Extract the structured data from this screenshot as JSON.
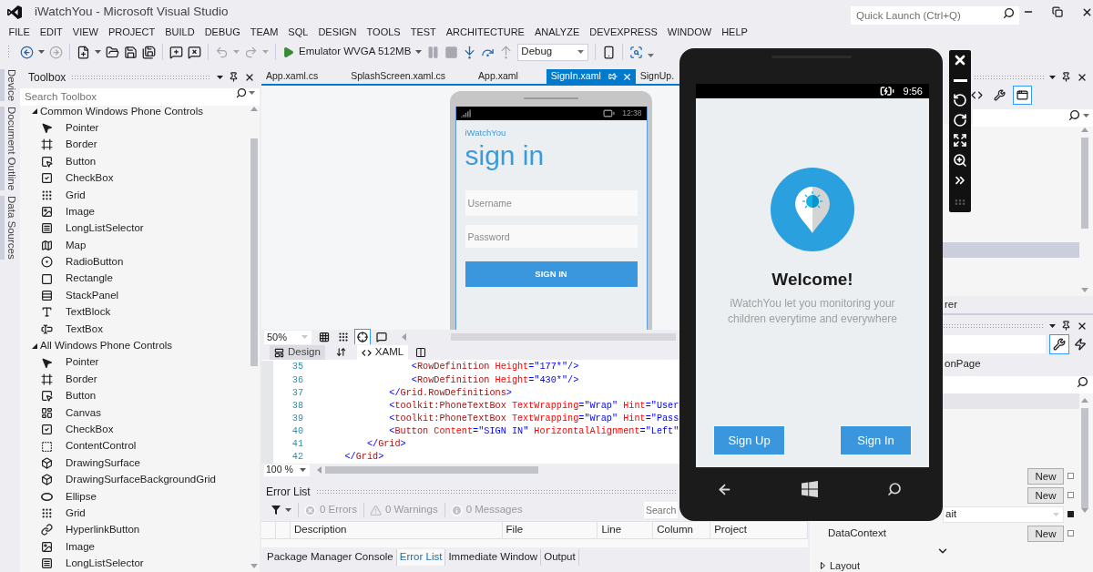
{
  "window": {
    "title": "iWatchYou - Microsoft Visual Studio",
    "quick_launch": {
      "placeholder": "Quick Launch (Ctrl+Q)"
    }
  },
  "menu": [
    "FILE",
    "EDIT",
    "VIEW",
    "PROJECT",
    "BUILD",
    "DEBUG",
    "TEAM",
    "SQL",
    "DESIGN",
    "TOOLS",
    "TEST",
    "ARCHITECTURE",
    "ANALYZE",
    "DEVEXPRESS",
    "WINDOW",
    "HELP"
  ],
  "toolbar": {
    "buttons": [
      {
        "kind": "back",
        "disabled": false
      },
      {
        "kind": "forward",
        "disabled": true
      },
      {
        "kind": "new",
        "disabled": false
      },
      {
        "kind": "open",
        "disabled": false
      },
      {
        "kind": "save",
        "disabled": false
      },
      {
        "kind": "saveall",
        "disabled": false
      },
      {
        "kind": "commentadd",
        "disabled": false
      },
      {
        "kind": "commentremove",
        "disabled": false
      },
      {
        "kind": "undo",
        "disabled": true
      },
      {
        "kind": "redo",
        "disabled": true
      }
    ],
    "target": "Emulator WVGA 512MB",
    "debug_buttons": [
      {
        "kind": "pause",
        "disabled": true
      },
      {
        "kind": "stop",
        "disabled": true
      },
      {
        "kind": "stepinto",
        "disabled": false
      },
      {
        "kind": "stepover",
        "disabled": false
      },
      {
        "kind": "stepout",
        "disabled": true
      }
    ],
    "configuration": "Debug"
  },
  "side_tabs": [
    "Device",
    "Document Outline",
    "Data Sources"
  ],
  "toolbox": {
    "title": "Toolbox",
    "search": {
      "placeholder": "Search Toolbox"
    },
    "groups": [
      {
        "name": "Common Windows Phone Controls",
        "expanded": true,
        "items": [
          {
            "label": "Pointer",
            "kind": "pointer"
          },
          {
            "label": "Border",
            "kind": "border"
          },
          {
            "label": "Button",
            "kind": "button"
          },
          {
            "label": "CheckBox",
            "kind": "checkbox"
          },
          {
            "label": "Grid",
            "kind": "grid"
          },
          {
            "label": "Image",
            "kind": "image"
          },
          {
            "label": "LongListSelector",
            "kind": "list"
          },
          {
            "label": "Map",
            "kind": "map"
          },
          {
            "label": "RadioButton",
            "kind": "radio"
          },
          {
            "label": "Rectangle",
            "kind": "rectangle"
          },
          {
            "label": "StackPanel",
            "kind": "stack"
          },
          {
            "label": "TextBlock",
            "kind": "text"
          },
          {
            "label": "TextBox",
            "kind": "textbox"
          }
        ]
      },
      {
        "name": "All Windows Phone Controls",
        "expanded": true,
        "items": [
          {
            "label": "Pointer",
            "kind": "pointer"
          },
          {
            "label": "Border",
            "kind": "border"
          },
          {
            "label": "Button",
            "kind": "button"
          },
          {
            "label": "Canvas",
            "kind": "canvas"
          },
          {
            "label": "CheckBox",
            "kind": "checkbox"
          },
          {
            "label": "ContentControl",
            "kind": "content"
          },
          {
            "label": "DrawingSurface",
            "kind": "surface"
          },
          {
            "label": "DrawingSurfaceBackgroundGrid",
            "kind": "surface"
          },
          {
            "label": "Ellipse",
            "kind": "ellipse"
          },
          {
            "label": "Grid",
            "kind": "grid"
          },
          {
            "label": "HyperlinkButton",
            "kind": "hyperlink"
          },
          {
            "label": "Image",
            "kind": "image"
          },
          {
            "label": "LongListSelector",
            "kind": "list"
          }
        ]
      }
    ]
  },
  "document_tabs": [
    {
      "label": "App.xaml.cs",
      "selected": false
    },
    {
      "label": "SplashScreen.xaml.cs",
      "selected": false
    },
    {
      "label": "App.xaml",
      "selected": false
    },
    {
      "label": "SignIn.xaml",
      "selected": true
    },
    {
      "label": "SignUp.",
      "selected": false
    }
  ],
  "designer": {
    "phone": {
      "clock": "12:38",
      "app_name": "iWatchYou",
      "page_title": "sign in",
      "fields": [
        {
          "placeholder": "Username"
        },
        {
          "placeholder": "Password"
        }
      ],
      "button": "SIGN IN"
    },
    "zoom": "50%",
    "tools": [
      {
        "kind": "grid",
        "on": false
      },
      {
        "kind": "snapgrid",
        "on": false
      },
      {
        "kind": "snaplines",
        "on": true
      },
      {
        "kind": "annotations",
        "on": false
      }
    ],
    "view_tabs": [
      {
        "kind": "design",
        "label": "Design",
        "selected": false
      },
      {
        "kind": "xaml",
        "label": "XAML",
        "selected": true
      }
    ]
  },
  "code": {
    "lines": [
      {
        "number": "35",
        "tokens": [
          {
            "kind": "bracket",
            "text": "                <"
          },
          {
            "kind": "element",
            "text": "RowDefinition"
          },
          {
            "kind": "attribute",
            "text": " Height"
          },
          {
            "kind": "bracket",
            "text": "="
          },
          {
            "kind": "value",
            "text": "\"177*\""
          },
          {
            "kind": "bracket",
            "text": "/>"
          }
        ]
      },
      {
        "number": "36",
        "tokens": [
          {
            "kind": "bracket",
            "text": "                <"
          },
          {
            "kind": "element",
            "text": "RowDefinition"
          },
          {
            "kind": "attribute",
            "text": " Height"
          },
          {
            "kind": "bracket",
            "text": "="
          },
          {
            "kind": "value",
            "text": "\"430*\""
          },
          {
            "kind": "bracket",
            "text": "/>"
          }
        ]
      },
      {
        "number": "37",
        "tokens": [
          {
            "kind": "bracket",
            "text": "            </"
          },
          {
            "kind": "element",
            "text": "Grid.RowDefinitions"
          },
          {
            "kind": "bracket",
            "text": ">"
          }
        ]
      },
      {
        "number": "38",
        "tokens": [
          {
            "kind": "bracket",
            "text": "            <"
          },
          {
            "kind": "element",
            "text": "toolkit:PhoneTextBox"
          },
          {
            "kind": "attribute",
            "text": " TextWrapping"
          },
          {
            "kind": "bracket",
            "text": "="
          },
          {
            "kind": "value",
            "text": "\"Wrap\""
          },
          {
            "kind": "attribute",
            "text": " Hint"
          },
          {
            "kind": "bracket",
            "text": "="
          },
          {
            "kind": "value",
            "text": "\"User"
          }
        ]
      },
      {
        "number": "39",
        "tokens": [
          {
            "kind": "bracket",
            "text": "            <"
          },
          {
            "kind": "element",
            "text": "toolkit:PhoneTextBox"
          },
          {
            "kind": "attribute",
            "text": " TextWrapping"
          },
          {
            "kind": "bracket",
            "text": "="
          },
          {
            "kind": "value",
            "text": "\"Wrap\""
          },
          {
            "kind": "attribute",
            "text": " Hint"
          },
          {
            "kind": "bracket",
            "text": "="
          },
          {
            "kind": "value",
            "text": "\"Pass"
          }
        ]
      },
      {
        "number": "40",
        "tokens": [
          {
            "kind": "bracket",
            "text": "            <"
          },
          {
            "kind": "element",
            "text": "Button"
          },
          {
            "kind": "attribute",
            "text": " Content"
          },
          {
            "kind": "bracket",
            "text": "="
          },
          {
            "kind": "value",
            "text": "\"SIGN IN\""
          },
          {
            "kind": "attribute",
            "text": " HorizontalAlignment"
          },
          {
            "kind": "bracket",
            "text": "="
          },
          {
            "kind": "value",
            "text": "\"Left\""
          }
        ]
      },
      {
        "number": "41",
        "tokens": [
          {
            "kind": "bracket",
            "text": "        </"
          },
          {
            "kind": "element",
            "text": "Grid"
          },
          {
            "kind": "bracket",
            "text": ">"
          }
        ]
      },
      {
        "number": "42",
        "tokens": [
          {
            "kind": "bracket",
            "text": "    </"
          },
          {
            "kind": "element",
            "text": "Grid"
          },
          {
            "kind": "bracket",
            "text": ">"
          }
        ]
      }
    ],
    "zoom": "100 %"
  },
  "error_list": {
    "title": "Error List",
    "filters": [
      {
        "kind": "errors",
        "label": "0 Errors"
      },
      {
        "kind": "warnings",
        "label": "0 Warnings"
      },
      {
        "kind": "messages",
        "label": "0 Messages"
      }
    ],
    "search": {
      "placeholder": "Search"
    },
    "columns": [
      "Description",
      "File",
      "Line",
      "Column",
      "Project"
    ]
  },
  "bottom_tabs": [
    {
      "label": "Package Manager Console",
      "selected": false
    },
    {
      "label": "Error List",
      "selected": true
    },
    {
      "label": "Immediate Window",
      "selected": false
    },
    {
      "label": "Output",
      "selected": false
    }
  ],
  "solution_explorer": {
    "tools": [
      {
        "kind": "code",
        "on": false
      },
      {
        "kind": "properties",
        "on": false
      },
      {
        "kind": "preview",
        "on": true
      }
    ],
    "tab": "rer"
  },
  "properties": {
    "views": [
      {
        "kind": "properties",
        "selected": true
      },
      {
        "kind": "events",
        "selected": false
      }
    ],
    "type": "onPage",
    "rows": [
      {
        "kind": "new",
        "button": "New",
        "set": false
      },
      {
        "kind": "new",
        "button": "New",
        "set": false
      },
      {
        "kind": "select",
        "value": "ait",
        "set": true
      },
      {
        "kind": "new",
        "name": "DataContext",
        "button": "New",
        "set": false
      }
    ],
    "section": {
      "name": "Layout",
      "expanded": false
    }
  },
  "emulator": {
    "clock": "9:56",
    "title": "Welcome!",
    "description": "iWatchYou let you monitoring your children everytime and everywhere",
    "buttons": [
      "Sign Up",
      "Sign In"
    ]
  }
}
